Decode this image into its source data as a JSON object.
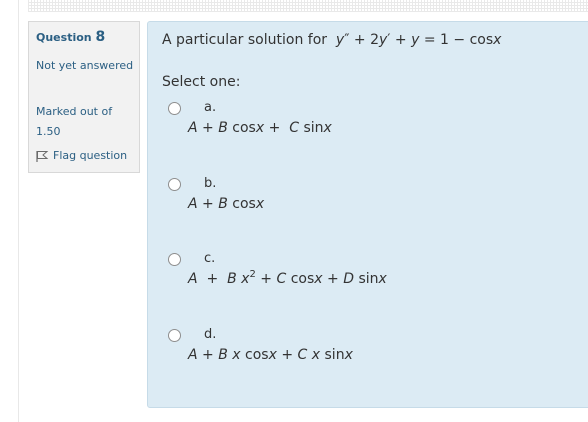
{
  "question": {
    "label": "Question",
    "number": "8",
    "state": "Not yet answered",
    "grade": "Marked out of 1.50",
    "flag_label": "Flag question",
    "text_lead": "A particular solution for",
    "prompt": "Select one:"
  },
  "options": [
    {
      "letter": "a.",
      "expr": "A + B cosx + C sinx"
    },
    {
      "letter": "b.",
      "expr": "A + B cosx"
    },
    {
      "letter": "c.",
      "expr": "A + B x^2 + C cosx + D sinx"
    },
    {
      "letter": "d.",
      "expr": "A + B x cosx + C x sinx"
    }
  ],
  "colors": {
    "accent": "#2b5f83",
    "content_bg": "#dcebf4",
    "info_bg": "#f2f2f2"
  }
}
